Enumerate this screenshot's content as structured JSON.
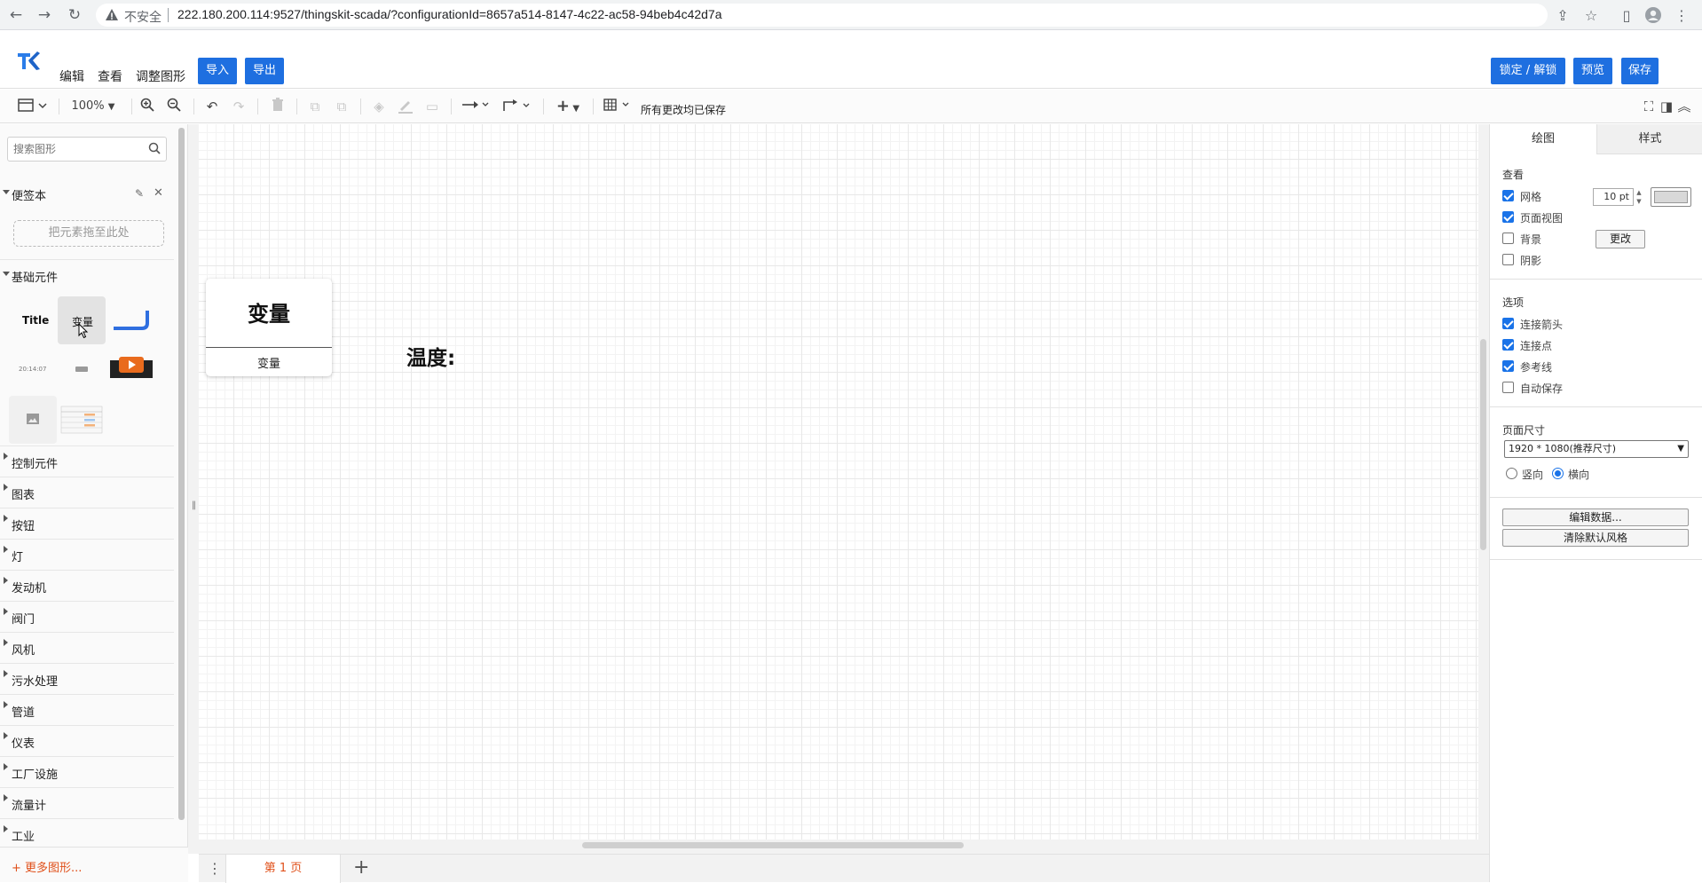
{
  "browser": {
    "insecure_label": "不安全",
    "url": "222.180.200.114:9527/thingskit-scada/?configurationId=8657a514-8147-4c22-ac58-94beb4c42d7a"
  },
  "header": {
    "menu": [
      "编辑",
      "查看",
      "调整图形"
    ],
    "import_label": "导入",
    "export_label": "导出",
    "lock_label": "锁定 / 解锁",
    "preview_label": "预览",
    "save_label": "保存"
  },
  "toolbar": {
    "zoom": "100%",
    "status": "所有更改均已保存"
  },
  "sidebar": {
    "search_placeholder": "搜索图形",
    "scratchpad": {
      "title": "便签本",
      "drop_hint": "把元素拖至此处"
    },
    "basic": {
      "title": "基础元件",
      "shapes": {
        "title_text": "Title",
        "variable_text": "变量",
        "clock_text": "20:14:07"
      }
    },
    "categories": [
      "控制元件",
      "图表",
      "按钮",
      "灯",
      "发动机",
      "阀门",
      "风机",
      "污水处理",
      "管道",
      "仪表",
      "工厂设施",
      "流量计",
      "工业"
    ],
    "more_label": "+ 更多图形..."
  },
  "canvas": {
    "variable_card": {
      "title": "变量",
      "subtitle": "变量"
    },
    "temp_label": "温度:"
  },
  "pages": {
    "tab": "第 1 页"
  },
  "right_panel": {
    "tabs": [
      "绘图",
      "样式"
    ],
    "view_section": "查看",
    "grid_label": "网格",
    "grid_size": "10 pt",
    "page_view_label": "页面视图",
    "background_label": "背景",
    "change_label": "更改",
    "shadow_label": "阴影",
    "options_section": "选项",
    "options": [
      {
        "label": "连接箭头",
        "checked": true
      },
      {
        "label": "连接点",
        "checked": true
      },
      {
        "label": "参考线",
        "checked": true
      },
      {
        "label": "自动保存",
        "checked": false
      }
    ],
    "page_size_section": "页面尺寸",
    "page_size_value": "1920 * 1080(推荐尺寸)",
    "portrait_label": "竖向",
    "landscape_label": "横向",
    "edit_data_label": "编辑数据...",
    "clear_style_label": "清除默认风格"
  },
  "colors": {
    "accent": "#1e6fe0",
    "orange": "#e0501a"
  }
}
